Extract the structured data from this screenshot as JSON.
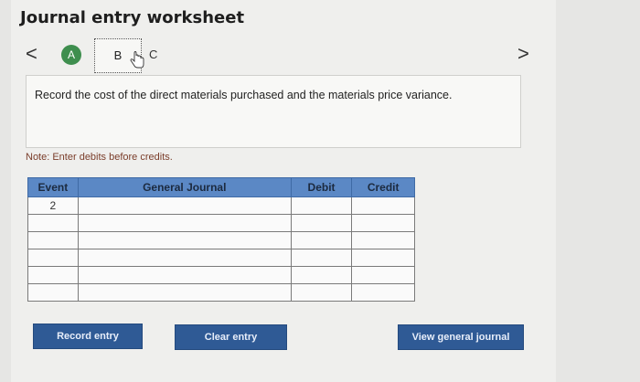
{
  "header": {
    "title": "Journal entry worksheet"
  },
  "nav": {
    "prev_label": "<",
    "next_label": ">",
    "steps": [
      {
        "label": "A"
      },
      {
        "label": "B"
      },
      {
        "label": "C"
      }
    ]
  },
  "instruction": {
    "text": "Record the cost of the direct materials purchased and the materials price variance."
  },
  "note": {
    "text": "Note: Enter debits before credits."
  },
  "journal_table": {
    "headers": {
      "event": "Event",
      "general_journal": "General Journal",
      "debit": "Debit",
      "credit": "Credit"
    },
    "rows": [
      {
        "event": "2",
        "account": "",
        "debit": "",
        "credit": ""
      },
      {
        "event": "",
        "account": "",
        "debit": "",
        "credit": ""
      },
      {
        "event": "",
        "account": "",
        "debit": "",
        "credit": ""
      },
      {
        "event": "",
        "account": "",
        "debit": "",
        "credit": ""
      },
      {
        "event": "",
        "account": "",
        "debit": "",
        "credit": ""
      },
      {
        "event": "",
        "account": "",
        "debit": "",
        "credit": ""
      }
    ]
  },
  "buttons": {
    "record": "Record entry",
    "clear": "Clear entry",
    "view": "View general journal"
  },
  "colors": {
    "accent": "#2f5a95",
    "header_fill": "#5b88c5",
    "step_a": "#3e8e4e",
    "note_text": "#7a3d2a"
  }
}
